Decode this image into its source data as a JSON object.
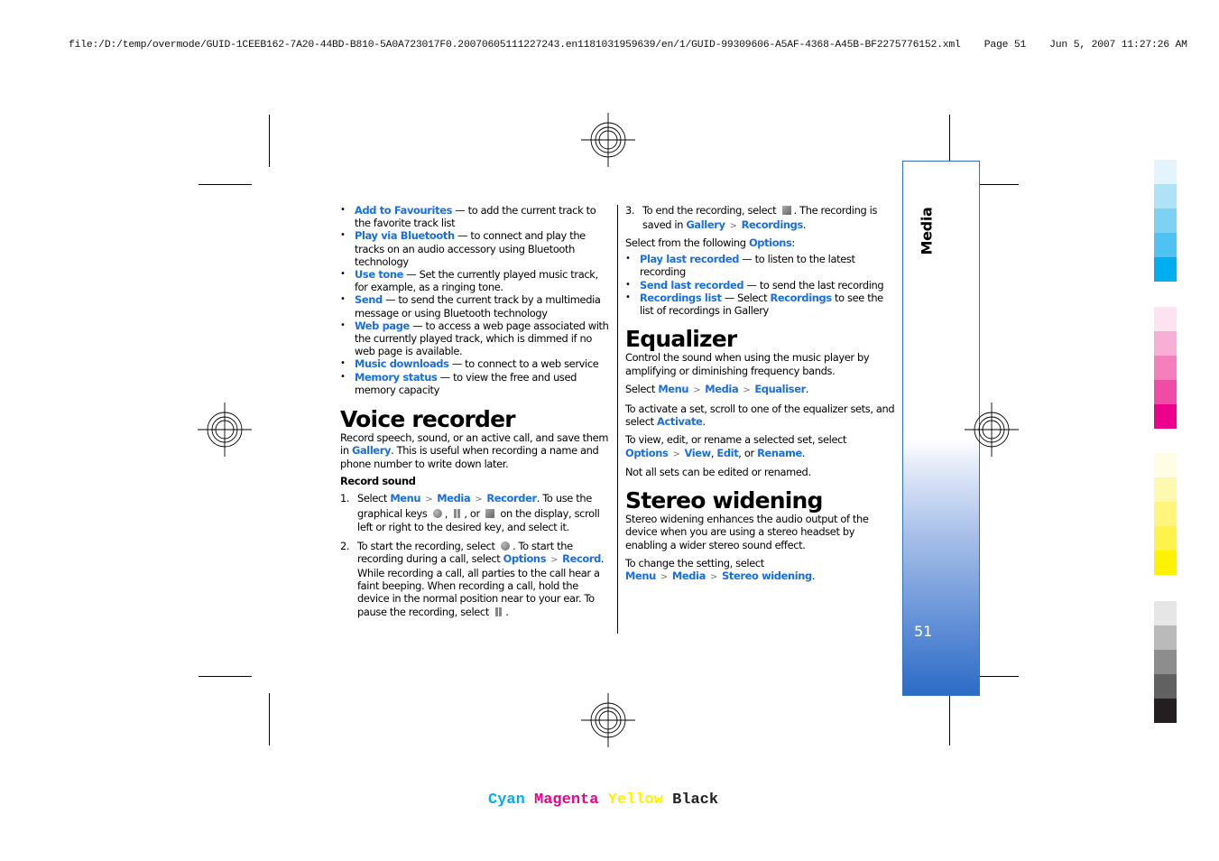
{
  "header": {
    "file_path": "file:/D:/temp/overmode/GUID-1CEEB162-7A20-44BD-B810-5A0A723017F0.20070605111227243.en1181031959639/en/1/GUID-99309606-A5AF-4368-A45B-BF2275776152.xml",
    "page_label": "Page 51",
    "timestamp": "Jun 5, 2007 11:27:26 AM"
  },
  "separator_glyph": ">",
  "left_column": {
    "options_list": [
      {
        "term": "Add to Favourites",
        "dash": " — ",
        "desc": " to add the current track to the favorite track list"
      },
      {
        "term": "Play via Bluetooth",
        "dash": " — ",
        "desc": " to connect and play the tracks on an audio accessory using Bluetooth technology"
      },
      {
        "term": "Use tone",
        "dash": " — ",
        "desc": "Set the currently played music track, for example, as a ringing tone."
      },
      {
        "term": "Send",
        "dash": " — ",
        "desc": " to send the current track by a multimedia message or using Bluetooth technology"
      },
      {
        "term": "Web page",
        "dash": " — ",
        "desc": " to access a web page associated with the currently played track, which is dimmed if no web page is available."
      },
      {
        "term": "Music downloads",
        "dash": " — ",
        "desc": " to connect to a web service"
      },
      {
        "term": "Memory status",
        "dash": " — ",
        "desc": " to view the free and used memory capacity"
      }
    ],
    "voice_recorder": {
      "heading": "Voice recorder",
      "intro_a": "Record speech, sound, or an active call, and save them in ",
      "intro_link": "Gallery",
      "intro_b": ". This is useful when recording a name and phone number to write down later.",
      "subheading": "Record sound",
      "step1": {
        "num": "1.",
        "a": "Select ",
        "menu": "Menu",
        "media": "Media",
        "recorder": "Recorder",
        "b": ". To use the graphical keys ",
        "c": ", ",
        "d": ", or ",
        "e": " on the display, scroll left or right to the desired key, and select it."
      },
      "step2": {
        "num": "2.",
        "a": "To start the recording, select ",
        "b": ". To start the recording during a call, select ",
        "options": "Options",
        "record": "Record",
        "c": ". While recording a call, all parties to the call hear a faint beeping. When recording a call, hold the device in the normal position near to your ear. To pause the recording, select ",
        "d": "."
      }
    }
  },
  "right_column": {
    "step3": {
      "num": "3.",
      "a": "To end the recording, select ",
      "b": ". The recording is saved in ",
      "gallery": "Gallery",
      "recordings": "Recordings",
      "c": "."
    },
    "options_intro_a": "Select from the following ",
    "options_intro_link": "Options",
    "options_intro_b": ":",
    "recorder_options": [
      {
        "term": "Play last recorded",
        "dash": " — ",
        "desc": " to listen to the latest recording"
      },
      {
        "term": "Send last recorded",
        "dash": " — ",
        "desc": " to send the last recording"
      },
      {
        "term": "Recordings list",
        "dash": " — ",
        "desc_a": "Select ",
        "desc_link": "Recordings",
        "desc_b": " to see the list of recordings in Gallery"
      }
    ],
    "equalizer": {
      "heading": "Equalizer",
      "p1": "Control the sound when using the music player by amplifying or diminishing frequency bands.",
      "p2_a": "Select ",
      "menu": "Menu",
      "media": "Media",
      "equaliser": "Equaliser",
      "p2_b": ".",
      "p3_a": "To activate a set, scroll to one of the equalizer sets, and select ",
      "activate": "Activate",
      "p3_b": ".",
      "p4_a": "To view, edit, or rename a selected set, select ",
      "options": "Options",
      "view": "View",
      "comma": ", ",
      "edit": "Edit",
      "or": ", or ",
      "rename": "Rename",
      "p4_b": ".",
      "p5": "Not all sets can be edited or renamed."
    },
    "stereo": {
      "heading": "Stereo widening",
      "p1": "Stereo widening enhances the audio output of the device when you are using a stereo headset by enabling a wider stereo sound effect.",
      "p2_a": "To change the setting, select ",
      "menu": "Menu",
      "media": "Media",
      "stereo_widening": "Stereo widening",
      "p2_b": "."
    }
  },
  "sidebar": {
    "section_title": "Media",
    "page_number": "51",
    "accent_color": "#2c6bc6"
  },
  "link_color": "#1a6fe0",
  "color_bars": {
    "cyan": [
      "#e3f4fc",
      "#ade2f7",
      "#7dd2f4",
      "#4ec2f0",
      "#00aeef"
    ],
    "magenta": [
      "#fde3f0",
      "#f8afd5",
      "#f47fbd",
      "#f04ba6",
      "#ec008c"
    ],
    "yellow": [
      "#fffde4",
      "#fff9b0",
      "#fff57d",
      "#fff24a",
      "#fff200"
    ],
    "black": [
      "#e6e6e6",
      "#bababa",
      "#8d8d8d",
      "#616161",
      "#231f20"
    ]
  },
  "process_colors": [
    {
      "label": "Cyan",
      "color": "#00aeef"
    },
    {
      "label": "Magenta",
      "color": "#ec008c"
    },
    {
      "label": "Yellow",
      "color": "#fff200"
    },
    {
      "label": "Black",
      "color": "#231f20"
    }
  ]
}
